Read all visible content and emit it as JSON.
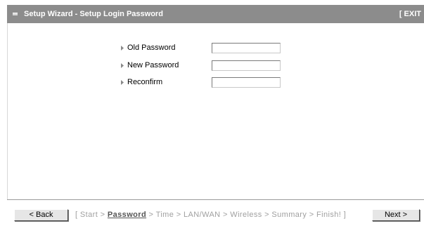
{
  "window": {
    "title": "Setup Wizard - Setup Login Password",
    "exit_label": "[ EXIT"
  },
  "form": {
    "fields": [
      {
        "label": "Old Password",
        "value": "",
        "type": "password"
      },
      {
        "label": "New Password",
        "value": "",
        "type": "password"
      },
      {
        "label": "Reconfirm",
        "value": "",
        "type": "password"
      }
    ]
  },
  "footer": {
    "back_label": "< Back",
    "next_label": "Next >",
    "steps": {
      "open_bracket": "[ ",
      "start": "Start",
      "sep1": " > ",
      "password": "Password",
      "sep2": " > ",
      "time": "Time",
      "sep3": " > ",
      "lanwan": "LAN/WAN",
      "sep4": " > ",
      "wireless": "Wireless",
      "sep5": " > ",
      "summary": "Summary",
      "sep6": " > ",
      "finish": "Finish!",
      "close_bracket": " ]"
    },
    "current_step": "Password"
  },
  "colors": {
    "title_bar_bg": "#8c8c8c",
    "title_text": "#ffffff",
    "step_inactive": "#a0a0a0",
    "step_active": "#555555"
  },
  "icons": {
    "title": "bullet-icon",
    "field_marker": "triangle-right-icon"
  }
}
